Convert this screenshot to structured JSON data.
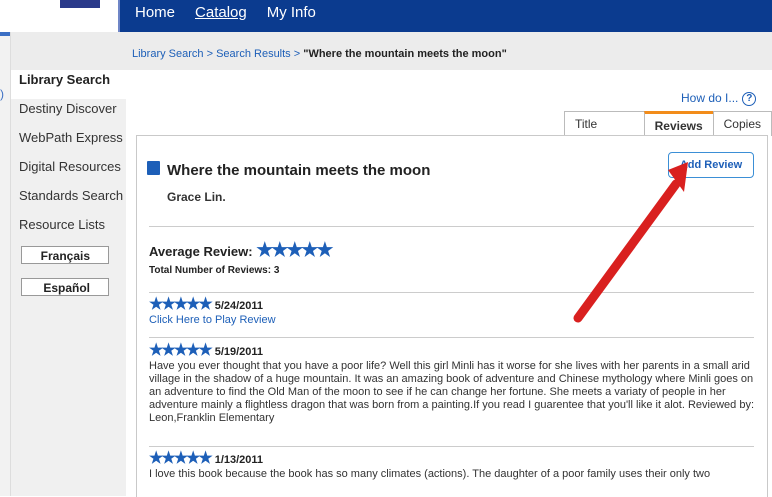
{
  "nav": {
    "home": "Home",
    "catalog": "Catalog",
    "myinfo": "My Info"
  },
  "breadcrumb": {
    "part1": "Library Search",
    "sep": " > ",
    "part2": "Search Results",
    "current": "\"Where the mountain meets the moon\""
  },
  "sidebar": {
    "items": [
      {
        "label": "Library Search"
      },
      {
        "label": "Destiny Discover"
      },
      {
        "label": "WebPath Express"
      },
      {
        "label": "Digital Resources"
      },
      {
        "label": "Standards Search"
      },
      {
        "label": "Resource Lists"
      }
    ],
    "languages": [
      "Français",
      "Español"
    ]
  },
  "help": {
    "label": "How do I...",
    "icon": "help-icon"
  },
  "tabs": [
    {
      "label": "Title Details"
    },
    {
      "label": "Reviews"
    },
    {
      "label": "Copies"
    }
  ],
  "book": {
    "title": "Where the mountain meets the moon",
    "author": "Grace Lin."
  },
  "add_review_label": "Add Review",
  "average": {
    "label": "Average Review:",
    "stars": 5,
    "total_label": "Total Number of Reviews: 3"
  },
  "stars_glyph": "★★★★★",
  "reviews": [
    {
      "date": "5/24/2011",
      "link": "Click Here to Play Review"
    },
    {
      "date": "5/19/2011",
      "text": "Have you ever thought that you have a poor life? Well this girl Minli has it worse for she lives with her parents in a small arid village in the shadow of a huge mountain. It was an amazing book of adventure and Chinese mythology where Minli goes on an adventure to find the Old Man of the moon to see if he can change her fortune. She meets a variaty of people in her adventure mainly a flightless dragon that was born from a painting.If you read I guarentee that you'll like it alot. Reviewed by: Leon,Franklin Elementary"
    },
    {
      "date": "1/13/2011",
      "text": "I love this book because the book has so many climates (actions). The daughter of a poor family uses their only two"
    }
  ],
  "colors": {
    "nav_bg": "#0b3b8f",
    "accent": "#1d5fb8",
    "active_tab": "#f28c1a",
    "arrow": "#d9201f"
  }
}
